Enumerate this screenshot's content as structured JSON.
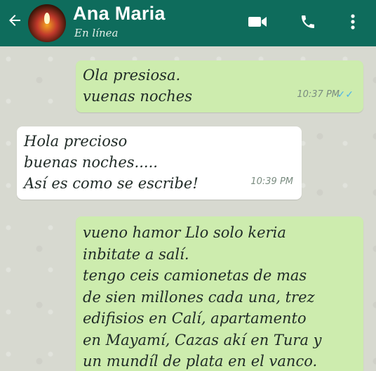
{
  "header": {
    "contact_name": "Ana Maria",
    "status": "En línea",
    "color": "#0e6c5c",
    "icons": [
      "back-arrow-icon",
      "avatar",
      "video-call-icon",
      "phone-call-icon",
      "more-options-icon"
    ]
  },
  "messages": [
    {
      "direction": "outgoing",
      "lines": [
        "Ola presiosa.",
        "vuenas noches"
      ],
      "time": "10:37 PM",
      "read_ticks": "✓✓"
    },
    {
      "direction": "incoming",
      "lines": [
        "Hola precioso",
        "buenas noches.....",
        "Así es como se escribe!"
      ],
      "time": "10:39 PM"
    },
    {
      "direction": "outgoing",
      "lines": [
        "vueno hamor Llo solo keria",
        "inbitate a salí.",
        "tengo ceis camionetas de mas",
        "de sien millones cada una, trez",
        "edifisios en Calí, apartamento",
        "en Mayamí, Cazas akí en Tura y",
        "un mundíl de plata en el vanco."
      ]
    }
  ]
}
